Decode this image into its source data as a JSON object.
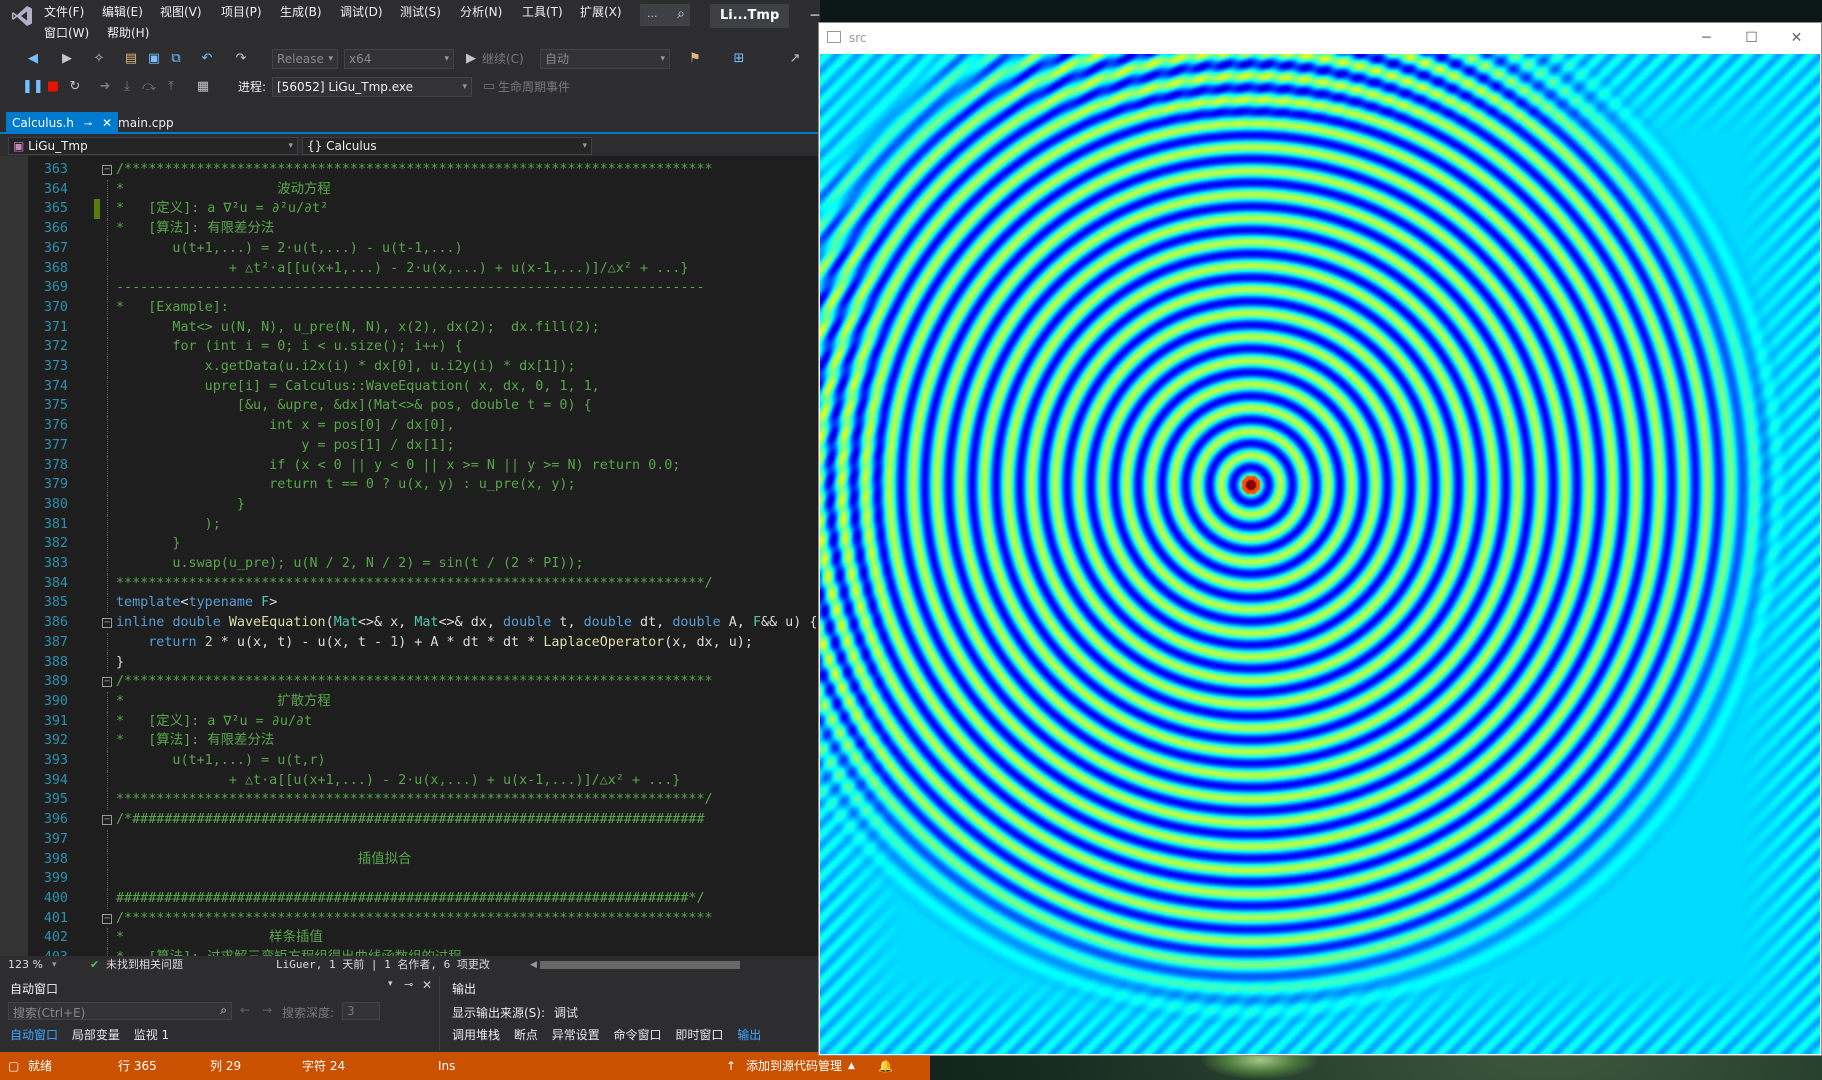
{
  "vs": {
    "menu": [
      "文件(F)",
      "编辑(E)",
      "视图(V)",
      "项目(P)",
      "生成(B)",
      "调试(D)",
      "测试(S)",
      "分析(N)",
      "工具(T)",
      "扩展(X)"
    ],
    "menu_row2": [
      "窗口(W)",
      "帮助(H)"
    ],
    "search_dots": "...",
    "solution_title": "Li...Tmp",
    "toolbar": {
      "config": "Release",
      "platform": "x64",
      "continue": "继续(C)",
      "auto": "自动",
      "process_label": "进程:",
      "process": "[56052] LiGu_Tmp.exe",
      "lifecycle": "生命周期事件"
    },
    "tabs": [
      {
        "label": "Calculus.h",
        "active": true
      },
      {
        "label": "main.cpp",
        "active": false
      }
    ],
    "nav": {
      "project": "LiGu_Tmp",
      "scope": "Calculus"
    },
    "code": [
      {
        "n": "363",
        "fold": "⊟",
        "parts": [
          [
            "c-cmt",
            "/*************************************************************************"
          ]
        ]
      },
      {
        "n": "364",
        "parts": [
          [
            "c-cmt",
            "*                   波动方程"
          ]
        ]
      },
      {
        "n": "365",
        "change": true,
        "parts": [
          [
            "c-cmt",
            "*   [定义]: a ∇²u = ∂²u/∂t²"
          ]
        ]
      },
      {
        "n": "366",
        "parts": [
          [
            "c-cmt",
            "*   [算法]: 有限差分法"
          ]
        ]
      },
      {
        "n": "367",
        "parts": [
          [
            "c-cmt",
            "       u(t+1,...) = 2·u(t,...) - u(t-1,...)"
          ]
        ]
      },
      {
        "n": "368",
        "parts": [
          [
            "c-cmt",
            "              + △t²·a[[u(x+1,...) - 2·u(x,...) + u(x-1,...)]/△x² + ...}"
          ]
        ]
      },
      {
        "n": "369",
        "parts": [
          [
            "c-cmt",
            "-------------------------------------------------------------------------"
          ]
        ]
      },
      {
        "n": "370",
        "parts": [
          [
            "c-cmt",
            "*   [Example]:"
          ]
        ]
      },
      {
        "n": "371",
        "parts": [
          [
            "c-cmt",
            "       Mat<> u(N, N), u_pre(N, N), x(2), dx(2);  dx.fill(2);"
          ]
        ]
      },
      {
        "n": "372",
        "parts": [
          [
            "c-cmt",
            "       for (int i = 0; i < u.size(); i++) {"
          ]
        ]
      },
      {
        "n": "373",
        "parts": [
          [
            "c-cmt",
            "           x.getData(u.i2x(i) * dx[0], u.i2y(i) * dx[1]);"
          ]
        ]
      },
      {
        "n": "374",
        "parts": [
          [
            "c-cmt",
            "           upre[i] = Calculus::WaveEquation( x, dx, 0, 1, 1,"
          ]
        ]
      },
      {
        "n": "375",
        "parts": [
          [
            "c-cmt",
            "               [&u, &upre, &dx](Mat<>& pos, double t = 0) {"
          ]
        ]
      },
      {
        "n": "376",
        "parts": [
          [
            "c-cmt",
            "                   int x = pos[0] / dx[0],"
          ]
        ]
      },
      {
        "n": "377",
        "parts": [
          [
            "c-cmt",
            "                       y = pos[1] / dx[1];"
          ]
        ]
      },
      {
        "n": "378",
        "parts": [
          [
            "c-cmt",
            "                   if (x < 0 || y < 0 || x >= N || y >= N) return 0.0;"
          ]
        ]
      },
      {
        "n": "379",
        "parts": [
          [
            "c-cmt",
            "                   return t == 0 ? u(x, y) : u_pre(x, y);"
          ]
        ]
      },
      {
        "n": "380",
        "parts": [
          [
            "c-cmt",
            "               }"
          ]
        ]
      },
      {
        "n": "381",
        "parts": [
          [
            "c-cmt",
            "           );"
          ]
        ]
      },
      {
        "n": "382",
        "parts": [
          [
            "c-cmt",
            "       }"
          ]
        ]
      },
      {
        "n": "383",
        "parts": [
          [
            "c-cmt",
            "       u.swap(u_pre); u(N / 2, N / 2) = sin(t / (2 * PI));"
          ]
        ]
      },
      {
        "n": "384",
        "parts": [
          [
            "c-cmt",
            "*************************************************************************/"
          ]
        ]
      },
      {
        "n": "385",
        "parts": [
          [
            "c-kw",
            "template"
          ],
          [
            "c-txt",
            "<"
          ],
          [
            "c-kw",
            "typename"
          ],
          [
            "c-txt",
            " "
          ],
          [
            "c-type",
            "F"
          ],
          [
            "c-txt",
            ">"
          ]
        ]
      },
      {
        "n": "386",
        "fold": "⊟",
        "parts": [
          [
            "c-kw",
            "inline"
          ],
          [
            "c-txt",
            " "
          ],
          [
            "c-kw",
            "double"
          ],
          [
            "c-txt",
            " "
          ],
          [
            "c-fn",
            "WaveEquation"
          ],
          [
            "c-txt",
            "("
          ],
          [
            "c-type",
            "Mat"
          ],
          [
            "c-txt",
            "<>& x, "
          ],
          [
            "c-type",
            "Mat"
          ],
          [
            "c-txt",
            "<>& dx, "
          ],
          [
            "c-kw",
            "double"
          ],
          [
            "c-txt",
            " t, "
          ],
          [
            "c-kw",
            "double"
          ],
          [
            "c-txt",
            " dt, "
          ],
          [
            "c-kw",
            "double"
          ],
          [
            "c-txt",
            " A, "
          ],
          [
            "c-type",
            "F"
          ],
          [
            "c-txt",
            "&& u) {"
          ]
        ]
      },
      {
        "n": "387",
        "parts": [
          [
            "c-txt",
            "    "
          ],
          [
            "c-kw",
            "return"
          ],
          [
            "c-txt",
            " "
          ],
          [
            "c-num",
            "2"
          ],
          [
            "c-txt",
            " * u(x, t) - u(x, t - "
          ],
          [
            "c-num",
            "1"
          ],
          [
            "c-txt",
            ") + A * dt * dt * "
          ],
          [
            "c-fn",
            "LaplaceOperator"
          ],
          [
            "c-txt",
            "(x, dx, u);"
          ]
        ]
      },
      {
        "n": "388",
        "parts": [
          [
            "c-txt",
            "}"
          ]
        ]
      },
      {
        "n": "389",
        "fold": "⊟",
        "parts": [
          [
            "c-cmt",
            "/*************************************************************************"
          ]
        ]
      },
      {
        "n": "390",
        "parts": [
          [
            "c-cmt",
            "*                   扩散方程"
          ]
        ]
      },
      {
        "n": "391",
        "parts": [
          [
            "c-cmt",
            "*   [定义]: a ∇²u = ∂u/∂t"
          ]
        ]
      },
      {
        "n": "392",
        "parts": [
          [
            "c-cmt",
            "*   [算法]: 有限差分法"
          ]
        ]
      },
      {
        "n": "393",
        "parts": [
          [
            "c-cmt",
            "       u(t+1,...) = u(t,r)"
          ]
        ]
      },
      {
        "n": "394",
        "parts": [
          [
            "c-cmt",
            "              + △t·a[[u(x+1,...) - 2·u(x,...) + u(x-1,...)]/△x² + ...}"
          ]
        ]
      },
      {
        "n": "395",
        "parts": [
          [
            "c-cmt",
            "*************************************************************************/"
          ]
        ]
      },
      {
        "n": "396",
        "fold": "⊟",
        "parts": [
          [
            "c-cmt",
            "/*#######################################################################"
          ]
        ]
      },
      {
        "n": "397",
        "parts": [
          [
            "c-cmt",
            ""
          ]
        ]
      },
      {
        "n": "398",
        "parts": [
          [
            "c-cmt",
            "                              插值拟合"
          ]
        ]
      },
      {
        "n": "399",
        "parts": [
          [
            "c-cmt",
            ""
          ]
        ]
      },
      {
        "n": "400",
        "parts": [
          [
            "c-cmt",
            "#######################################################################*/"
          ]
        ]
      },
      {
        "n": "401",
        "fold": "⊟",
        "parts": [
          [
            "c-cmt",
            "/*************************************************************************"
          ]
        ]
      },
      {
        "n": "402",
        "parts": [
          [
            "c-cmt",
            "*                  样条插值"
          ]
        ]
      },
      {
        "n": "403",
        "parts": [
          [
            "c-cmt",
            "*   [算法]: 过求解三弯矩方程组得出曲线函数组的过程"
          ]
        ]
      }
    ],
    "editor_status": {
      "zoom": "123 %",
      "issues": "未找到相关问题",
      "codelens": "LiGuer, 1 天前 | 1 名作者, 6 项更改"
    },
    "auto_window": {
      "title": "自动窗口",
      "search_placeholder": "搜索(Ctrl+E)",
      "depth_label": "搜索深度:",
      "depth": "3",
      "tabs": [
        "自动窗口",
        "局部变量",
        "监视 1"
      ]
    },
    "output_window": {
      "title": "输出",
      "source_label": "显示输出来源(S):",
      "source": "调试",
      "tabs": [
        "调用堆栈",
        "断点",
        "异常设置",
        "命令窗口",
        "即时窗口",
        "输出"
      ]
    },
    "statusbar": {
      "ready": "就绪",
      "line": "行 365",
      "col": "列 29",
      "ch": "字符 24",
      "ins": "Ins",
      "scm": "添加到源代码管理"
    }
  },
  "src_window": {
    "title": "src",
    "colors": {
      "background": "#00a8f5",
      "ring_dark": "#0a1ae0",
      "ring_light": "#00e8d8",
      "center_hot": "#ff1a00",
      "center_warm": "#ffee00"
    }
  }
}
